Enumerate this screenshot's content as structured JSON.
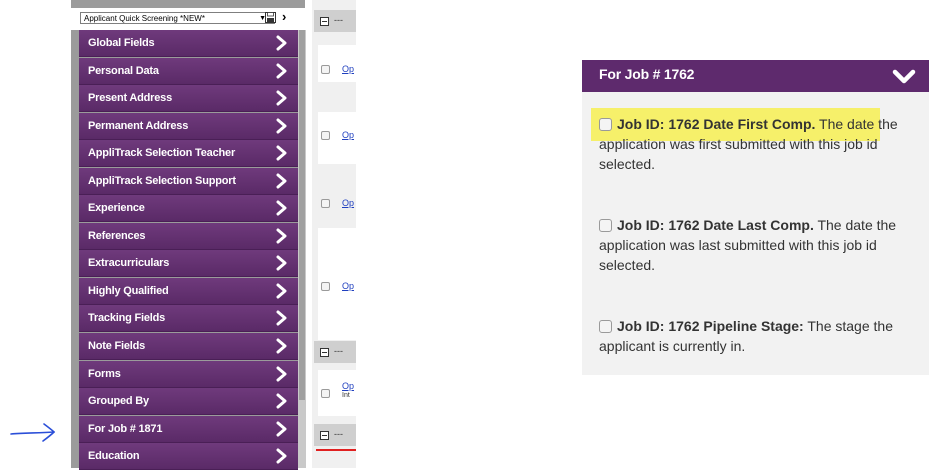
{
  "toolbar": {
    "select_value": "Applicant Quick Screening *NEW*"
  },
  "menu": [
    {
      "label": "Global Fields"
    },
    {
      "label": "Personal Data"
    },
    {
      "label": "Present Address"
    },
    {
      "label": "Permanent Address"
    },
    {
      "label": "AppliTrack Selection Teacher"
    },
    {
      "label": "AppliTrack Selection Support"
    },
    {
      "label": "Experience"
    },
    {
      "label": "References"
    },
    {
      "label": "Extracurriculars"
    },
    {
      "label": "Highly Qualified"
    },
    {
      "label": "Tracking Fields"
    },
    {
      "label": "Note Fields"
    },
    {
      "label": "Forms"
    },
    {
      "label": "Grouped By"
    },
    {
      "label": "For Job # 1871"
    },
    {
      "label": "Education"
    }
  ],
  "middle": {
    "header_dash": "---",
    "link_text": "Op",
    "small_text": "Int"
  },
  "job_panel": {
    "title": "For Job # 1762",
    "fields": [
      {
        "name": "Job ID: 1762 Date First Comp.",
        "description": " The date the application was first submitted with this job id selected."
      },
      {
        "name": "Job ID: 1762 Date Last Comp.",
        "description": " The date the application was last submitted with this job id selected."
      },
      {
        "name": "Job ID: 1762 Pipeline Stage:",
        "description": " The stage the applicant is currently in."
      }
    ]
  },
  "colors": {
    "menu_purple": "#5e2a6d",
    "highlight_yellow": "#f6f06a",
    "annotation_blue": "#2b4fd8"
  }
}
